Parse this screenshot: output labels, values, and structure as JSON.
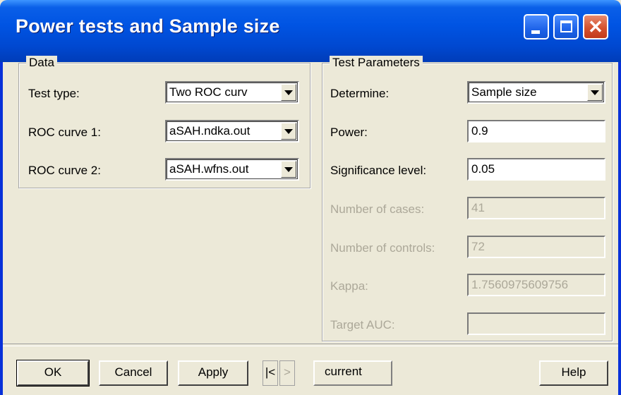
{
  "window": {
    "title": "Power tests and Sample size",
    "minimize_icon": "minimize-icon",
    "maximize_icon": "maximize-icon",
    "close_icon": "close-icon",
    "close_glyph": "✕"
  },
  "data_group": {
    "legend": "Data",
    "rows": [
      {
        "label": "Test type:",
        "value": "Two ROC curv"
      },
      {
        "label": "ROC curve 1:",
        "value": "aSAH.ndka.out"
      },
      {
        "label": "ROC curve 2:",
        "value": "aSAH.wfns.out"
      }
    ]
  },
  "test_params": {
    "legend": "Test Parameters",
    "determine": {
      "label": "Determine:",
      "value": "Sample size"
    },
    "power": {
      "label": "Power:",
      "value": "0.9"
    },
    "significance": {
      "label": "Significance level:",
      "value": "0.05"
    },
    "cases": {
      "label": "Number of cases:",
      "value": "41"
    },
    "controls": {
      "label": "Number of controls:",
      "value": "72"
    },
    "kappa": {
      "label": "Kappa:",
      "value": "1.7560975609756"
    },
    "target_auc": {
      "label": "Target AUC:",
      "value": ""
    }
  },
  "buttons": {
    "ok": "OK",
    "cancel": "Cancel",
    "apply": "Apply",
    "nav_first": "|<",
    "nav_next": ">",
    "current": "current",
    "help": "Help"
  }
}
